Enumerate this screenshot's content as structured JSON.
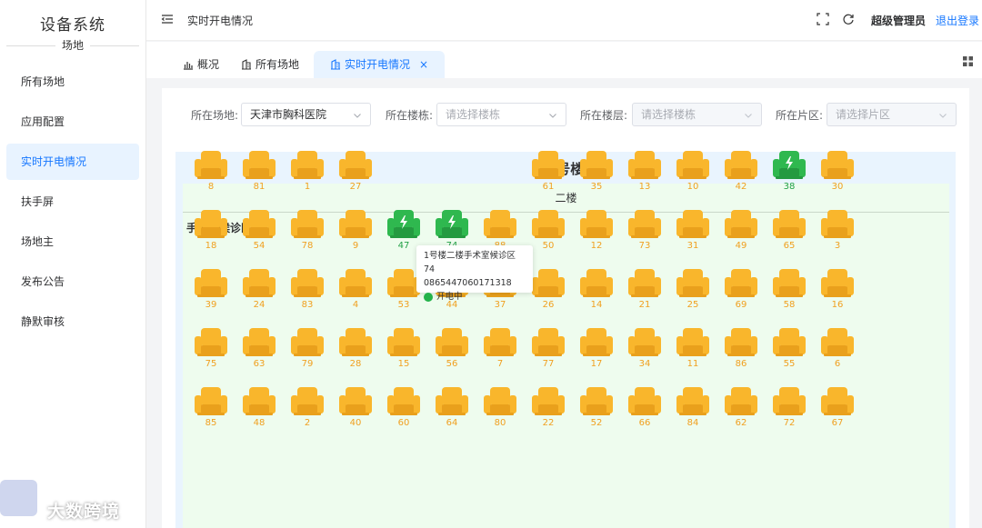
{
  "sidebar": {
    "title": "设备系统",
    "subtitle": "场地",
    "items": [
      {
        "label": "所有场地",
        "active": false
      },
      {
        "label": "应用配置",
        "active": false
      },
      {
        "label": "实时开电情况",
        "active": true
      },
      {
        "label": "扶手屏",
        "active": false
      },
      {
        "label": "场地主",
        "active": false
      },
      {
        "label": "发布公告",
        "active": false
      },
      {
        "label": "静默审核",
        "active": false
      }
    ]
  },
  "header": {
    "breadcrumb": "实时开电情况",
    "user": "超级管理员",
    "logout": "退出登录"
  },
  "tabs": [
    {
      "label": "概况",
      "icon": "bar-chart-icon",
      "active": false
    },
    {
      "label": "所有场地",
      "icon": "venue-icon",
      "active": false
    },
    {
      "label": "实时开电情况",
      "icon": "venue-icon",
      "active": true,
      "close": "×"
    }
  ],
  "filters": [
    {
      "label": "所在场地:",
      "value": "天津市胸科医院",
      "placeholder": false,
      "disabled": false
    },
    {
      "label": "所在楼栋:",
      "value": "请选择楼栋",
      "placeholder": true,
      "disabled": false
    },
    {
      "label": "所在楼层:",
      "value": "请选择楼栋",
      "placeholder": true,
      "disabled": true
    },
    {
      "label": "所在片区:",
      "value": "请选择片区",
      "placeholder": true,
      "disabled": true
    }
  ],
  "building": {
    "title": "1号楼",
    "floor": "二楼",
    "zone": "手术室候诊区"
  },
  "colors": {
    "seat_idle": "#f9b62c",
    "seat_on": "#2fb84f",
    "accent": "#1677ff"
  },
  "seat_rows": [
    [
      {
        "n": "8"
      },
      {
        "n": "81"
      },
      {
        "n": "1"
      },
      {
        "n": "27"
      },
      {
        "n": "",
        "hidden": true
      },
      {
        "n": "",
        "hidden": true
      },
      {
        "n": "",
        "hidden": true
      },
      {
        "n": "61"
      },
      {
        "n": "35"
      },
      {
        "n": "13"
      },
      {
        "n": "10"
      },
      {
        "n": "42"
      },
      {
        "n": "38",
        "on": true
      },
      {
        "n": "30"
      }
    ],
    [
      {
        "n": "18"
      },
      {
        "n": "54"
      },
      {
        "n": "78"
      },
      {
        "n": "9"
      },
      {
        "n": "47",
        "on": true
      },
      {
        "n": "74",
        "on": true
      },
      {
        "n": "88"
      },
      {
        "n": "50"
      },
      {
        "n": "12"
      },
      {
        "n": "73"
      },
      {
        "n": "31"
      },
      {
        "n": "49"
      },
      {
        "n": "65"
      },
      {
        "n": "3"
      }
    ],
    [
      {
        "n": "39"
      },
      {
        "n": "24"
      },
      {
        "n": "83"
      },
      {
        "n": "4"
      },
      {
        "n": "53"
      },
      {
        "n": "44"
      },
      {
        "n": "37"
      },
      {
        "n": "26"
      },
      {
        "n": "14"
      },
      {
        "n": "21"
      },
      {
        "n": "25"
      },
      {
        "n": "69"
      },
      {
        "n": "58"
      },
      {
        "n": "16"
      }
    ],
    [
      {
        "n": "75"
      },
      {
        "n": "63"
      },
      {
        "n": "79"
      },
      {
        "n": "28"
      },
      {
        "n": "15"
      },
      {
        "n": "56"
      },
      {
        "n": "7"
      },
      {
        "n": "77"
      },
      {
        "n": "17"
      },
      {
        "n": "34"
      },
      {
        "n": "11"
      },
      {
        "n": "86"
      },
      {
        "n": "55"
      },
      {
        "n": "6"
      }
    ],
    [
      {
        "n": "85"
      },
      {
        "n": "48"
      },
      {
        "n": "2"
      },
      {
        "n": "40"
      },
      {
        "n": "60"
      },
      {
        "n": "64"
      },
      {
        "n": "80"
      },
      {
        "n": "22"
      },
      {
        "n": "52"
      },
      {
        "n": "66"
      },
      {
        "n": "84"
      },
      {
        "n": "62"
      },
      {
        "n": "72"
      },
      {
        "n": "67"
      }
    ]
  ],
  "tooltip": {
    "line1": "1号楼二楼手术室候诊区74",
    "line2": "0865447060171318",
    "status": "开电中"
  },
  "watermark": "大数跨境"
}
